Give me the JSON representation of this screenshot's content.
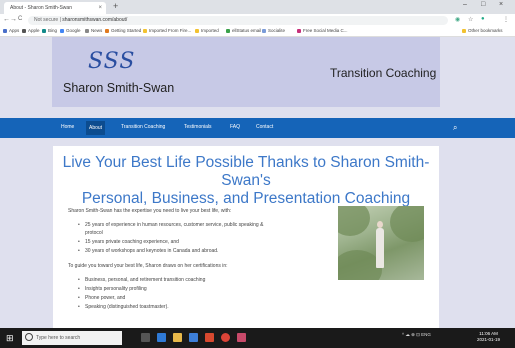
{
  "browser": {
    "tab_title": "About - Sharon Smith-Swan",
    "tab_close": "×",
    "new_tab": "+",
    "window_controls": [
      "–",
      "□",
      "×"
    ],
    "nav": [
      "←",
      "→",
      "C",
      "⌂"
    ],
    "url_prefix": "Not secure |",
    "url_domain": "sharonsmithswan.com/about/",
    "bookmarks": [
      {
        "label": "Apps",
        "color": "#4a6fc9"
      },
      {
        "label": "Apple",
        "color": "#555555"
      },
      {
        "label": "Bing",
        "color": "#138a8a"
      },
      {
        "label": "Google",
        "color": "#4285f4"
      },
      {
        "label": "News",
        "color": "#888888"
      },
      {
        "label": "Getting Started",
        "color": "#e07a1f"
      },
      {
        "label": "Imported From Fire...",
        "color": "#f2c230"
      },
      {
        "label": "Imported",
        "color": "#f2c230"
      },
      {
        "label": "ellStatus email",
        "color": "#3aa14a"
      },
      {
        "label": "Socialite",
        "color": "#7a9bd8"
      },
      {
        "label": "Free Social Media C...",
        "color": "#c7307a"
      }
    ],
    "other_bookmarks": "Other bookmarks"
  },
  "site": {
    "logo_initials": "SSS",
    "logo_name": "Sharon Smith-Swan",
    "tagline": "Transition Coaching",
    "nav": [
      "Home",
      "About",
      "Transition Coaching",
      "Testimonials",
      "FAQ",
      "Contact"
    ],
    "nav_active_index": 1,
    "search_icon": "search-icon",
    "heading_line1": "Live Your Best Life Possible Thanks to Sharon Smith-Swan's",
    "heading_line2": "Personal, Business, and Presentation Coaching",
    "intro": "Sharon Smith-Swan has the expertise you need to live your best life, with:",
    "bullets_1": [
      "25 years of experience in human resources, customer service, public speaking &",
      "protocol",
      "15 years private coaching experience, and",
      "30 years of workshops and keynotes in Canada and abroad."
    ],
    "guide_text": "To guide you toward your best life, Sharon draws on her certifications in:",
    "bullets_2": [
      "Business, personal, and retirement transition coaching",
      "Insights personality profiling",
      "Phone power, and",
      "Speaking (distinguished toastmaster)."
    ]
  },
  "taskbar": {
    "search_placeholder": "Type here to search",
    "clock_time": "11:06 AM",
    "clock_date": "2021-01-19",
    "tray": "^ ☁ ⊕ ⊡ ENG"
  }
}
